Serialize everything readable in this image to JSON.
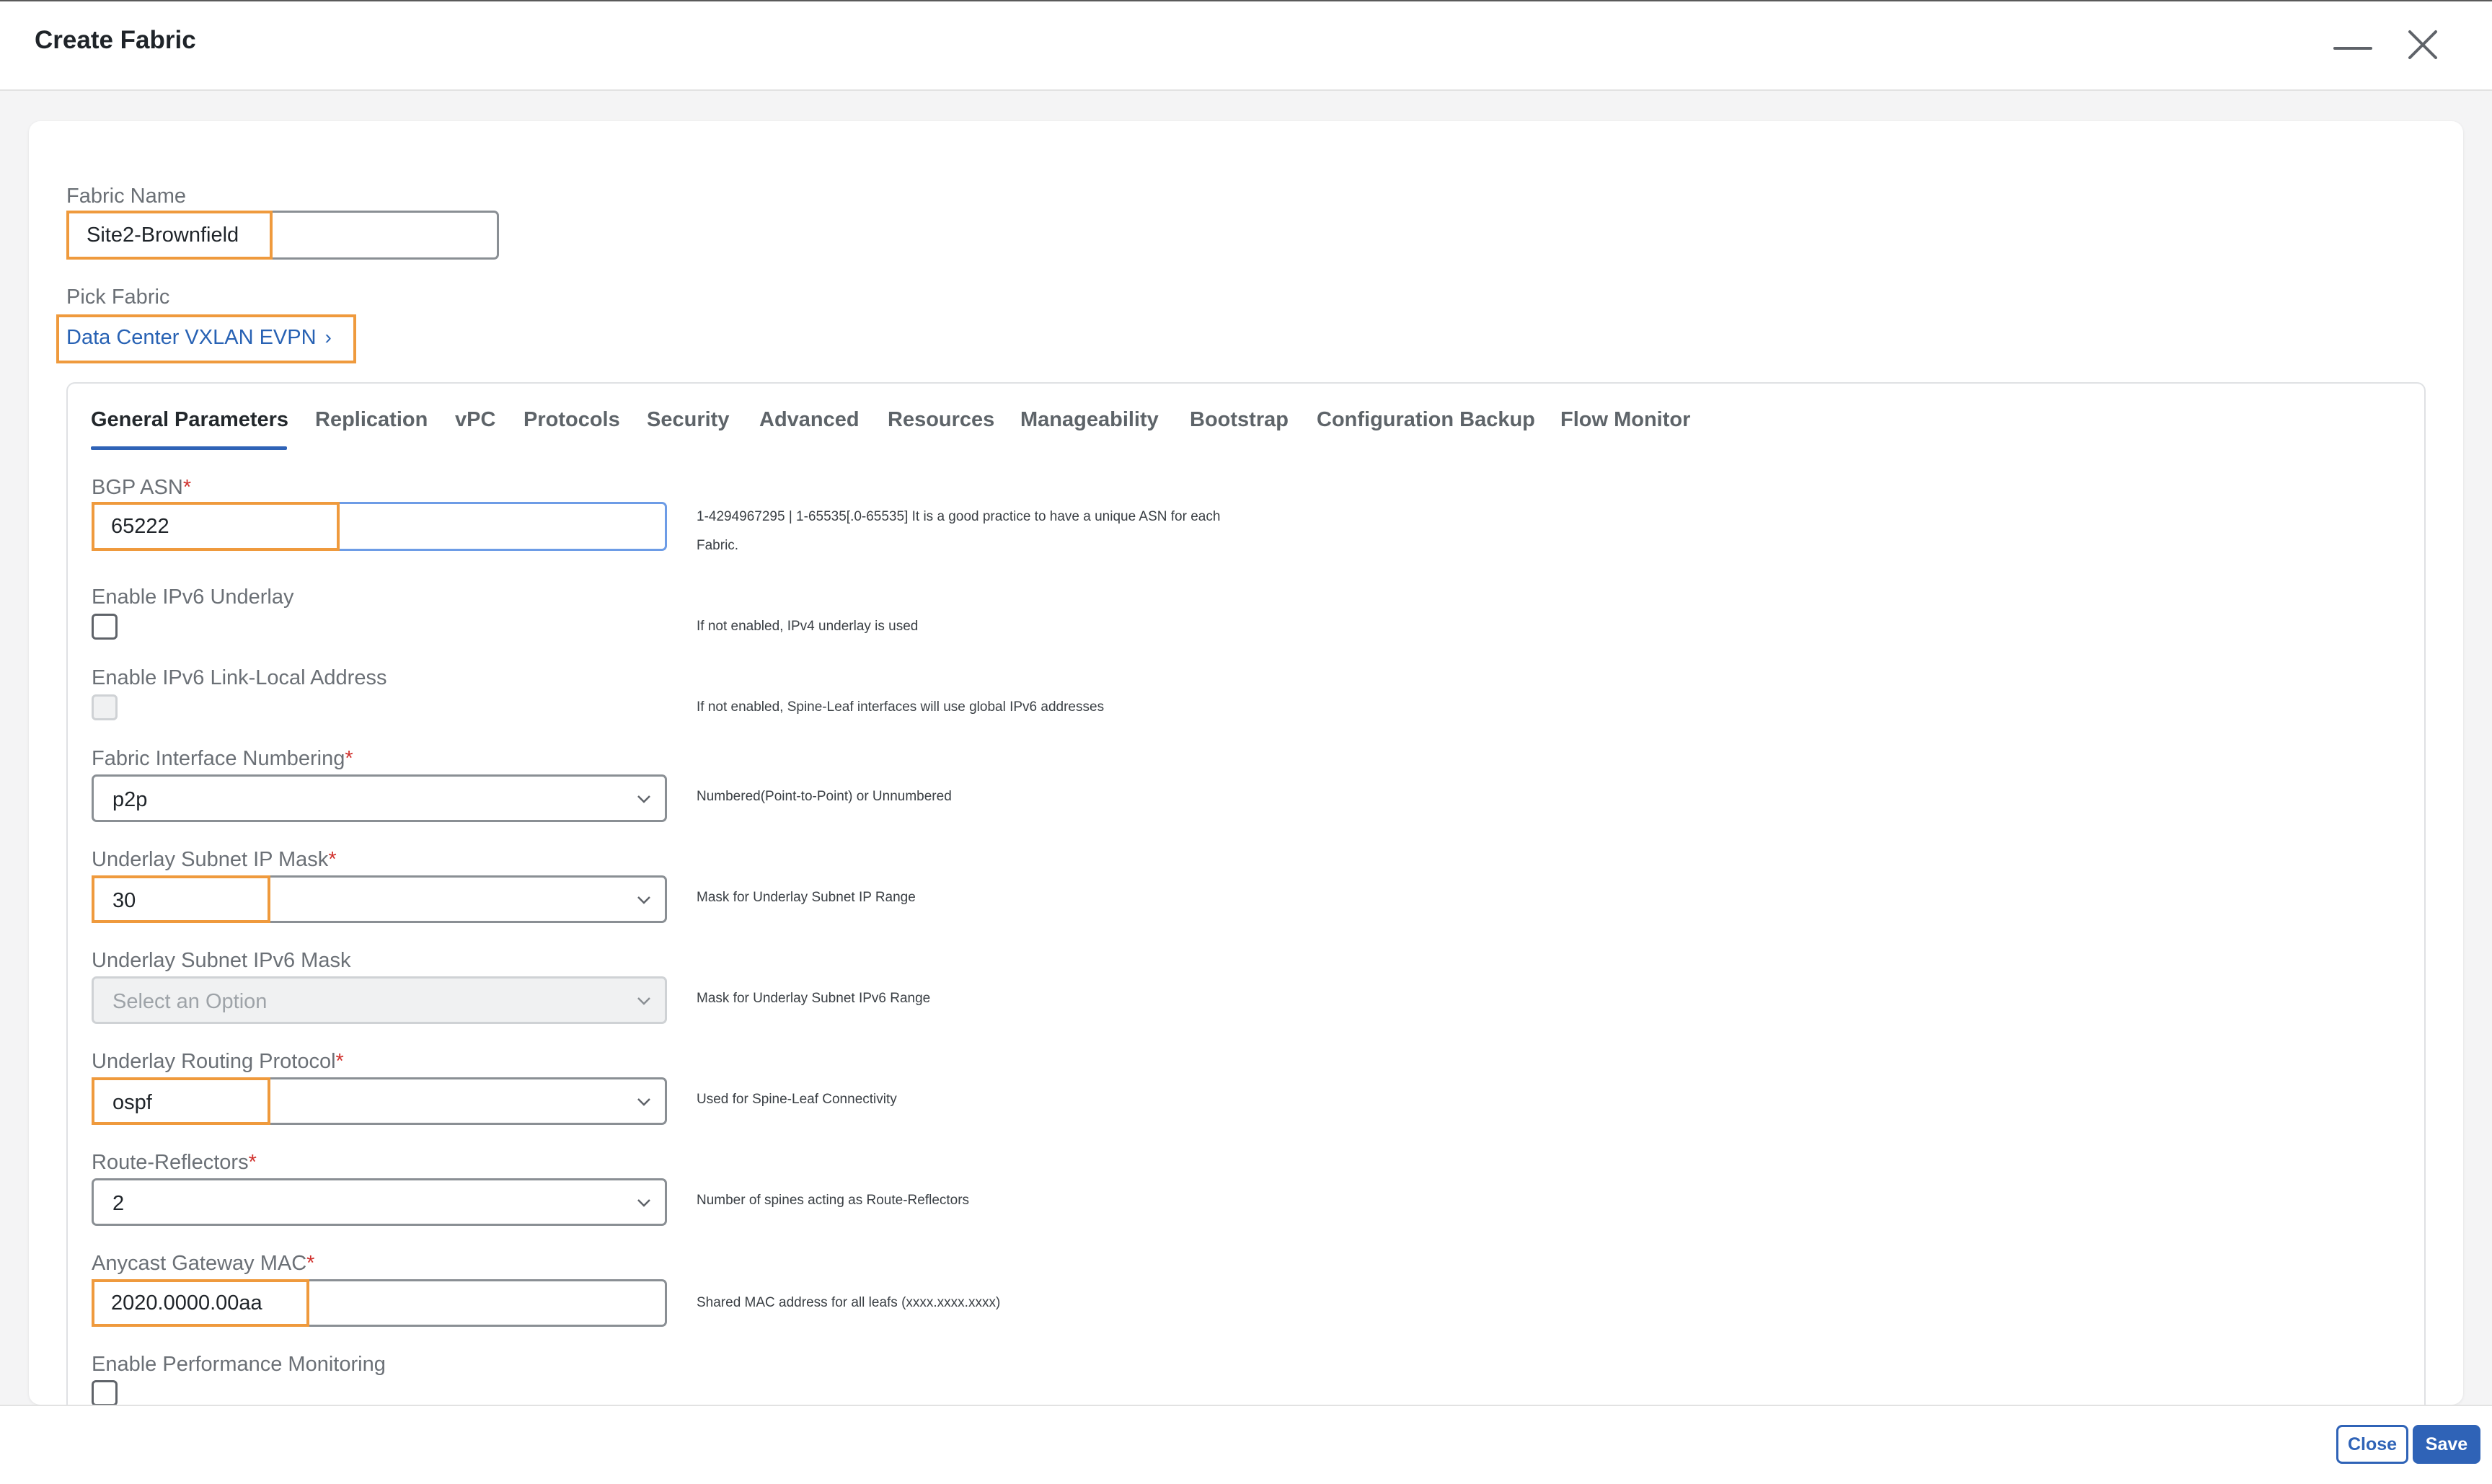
{
  "header": {
    "title": "Create Fabric"
  },
  "fabric_name": {
    "label": "Fabric Name",
    "value": "Site2-Brownfield"
  },
  "pick_fabric": {
    "label": "Pick Fabric",
    "link": "Data Center VXLAN EVPN"
  },
  "tabs": [
    {
      "label": "General Parameters",
      "active": true
    },
    {
      "label": "Replication"
    },
    {
      "label": "vPC"
    },
    {
      "label": "Protocols"
    },
    {
      "label": "Security"
    },
    {
      "label": "Advanced"
    },
    {
      "label": "Resources"
    },
    {
      "label": "Manageability"
    },
    {
      "label": "Bootstrap"
    },
    {
      "label": "Configuration Backup"
    },
    {
      "label": "Flow Monitor"
    }
  ],
  "fields": {
    "bgp_asn": {
      "label": "BGP ASN",
      "required": "*",
      "value": "65222",
      "help_line1": "1-4294967295 | 1-65535[.0-65535] It is a good practice to have a unique ASN for each",
      "help_line2": "Fabric."
    },
    "ipv6_underlay": {
      "label": "Enable IPv6 Underlay",
      "checked": false,
      "help": "If not enabled, IPv4 underlay is used"
    },
    "ipv6_link_local": {
      "label": "Enable IPv6 Link-Local Address",
      "checked": false,
      "disabled": true,
      "help": "If not enabled, Spine-Leaf interfaces will use global IPv6 addresses"
    },
    "interface_numbering": {
      "label": "Fabric Interface Numbering",
      "required": "*",
      "value": "p2p",
      "help": "Numbered(Point-to-Point) or Unnumbered"
    },
    "subnet_ip_mask": {
      "label": "Underlay Subnet IP Mask",
      "required": "*",
      "value": "30",
      "help": "Mask for Underlay Subnet IP Range"
    },
    "subnet_ipv6_mask": {
      "label": "Underlay Subnet IPv6 Mask",
      "placeholder": "Select an Option",
      "help": "Mask for Underlay Subnet IPv6 Range"
    },
    "routing_protocol": {
      "label": "Underlay Routing Protocol",
      "required": "*",
      "value": "ospf",
      "help": "Used for Spine-Leaf Connectivity"
    },
    "route_reflectors": {
      "label": "Route-Reflectors",
      "required": "*",
      "value": "2",
      "help": "Number of spines acting as Route-Reflectors"
    },
    "anycast_mac": {
      "label": "Anycast Gateway MAC",
      "required": "*",
      "value": "2020.0000.00aa",
      "help": "Shared MAC address for all leafs (xxxx.xxxx.xxxx)"
    },
    "perf_monitoring": {
      "label": "Enable Performance Monitoring",
      "checked": false
    }
  },
  "footer": {
    "close_label": "Close",
    "save_label": "Save"
  },
  "colors": {
    "accent": "#2f63b7",
    "highlight": "#ef9a3d",
    "required": "#d0312d",
    "link": "#2862b4"
  }
}
